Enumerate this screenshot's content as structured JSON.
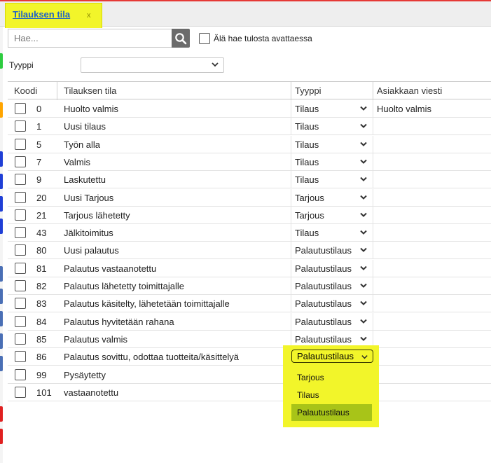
{
  "tab": {
    "label": "Tilauksen tila",
    "close": "x"
  },
  "search": {
    "placeholder": "Hae...",
    "option_label": "Älä hae tulosta avattaessa"
  },
  "filter": {
    "type_label": "Tyyppi",
    "type_value": ""
  },
  "table": {
    "headers": [
      "Koodi",
      "Tilauksen tila",
      "Tyyppi",
      "Asiakkaan viesti"
    ],
    "rows": [
      {
        "code": "0",
        "status": "Huolto valmis",
        "type": "Tilaus",
        "message": "Huolto valmis"
      },
      {
        "code": "1",
        "status": "Uusi tilaus",
        "type": "Tilaus",
        "message": ""
      },
      {
        "code": "5",
        "status": "Työn alla",
        "type": "Tilaus",
        "message": ""
      },
      {
        "code": "7",
        "status": "Valmis",
        "type": "Tilaus",
        "message": ""
      },
      {
        "code": "9",
        "status": "Laskutettu",
        "type": "Tilaus",
        "message": ""
      },
      {
        "code": "20",
        "status": "Uusi Tarjous",
        "type": "Tarjous",
        "message": ""
      },
      {
        "code": "21",
        "status": "Tarjous lähetetty",
        "type": "Tarjous",
        "message": ""
      },
      {
        "code": "43",
        "status": "Jälkitoimitus",
        "type": "Tilaus",
        "message": ""
      },
      {
        "code": "80",
        "status": "Uusi palautus",
        "type": "Palautustilaus",
        "message": ""
      },
      {
        "code": "81",
        "status": "Palautus vastaanotettu",
        "type": "Palautustilaus",
        "message": ""
      },
      {
        "code": "82",
        "status": "Palautus lähetetty toimittajalle",
        "type": "Palautustilaus",
        "message": ""
      },
      {
        "code": "83",
        "status": "Palautus käsitelty, lähetetään toimittajalle",
        "type": "Palautustilaus",
        "message": ""
      },
      {
        "code": "84",
        "status": "Palautus hyvitetään rahana",
        "type": "Palautustilaus",
        "message": ""
      },
      {
        "code": "85",
        "status": "Palautus valmis",
        "type": "Palautustilaus",
        "message": ""
      },
      {
        "code": "86",
        "status": "Palautus sovittu, odottaa tuotteita/käsittelyä",
        "type": "Palautustilaus",
        "message": ""
      },
      {
        "code": "99",
        "status": "Pysäytetty",
        "type": "",
        "message": ""
      },
      {
        "code": "101",
        "status": "vastaanotettu",
        "type": "",
        "message": ""
      }
    ]
  },
  "dropdown": {
    "selected": "Palautustilaus",
    "options": [
      "Tarjous",
      "Tilaus",
      "Palautustilaus"
    ]
  },
  "colors": {
    "highlight": "#f2f52a",
    "selected_option": "#a8c418",
    "tab_link": "#1e62c8",
    "top_line": "#e53935"
  }
}
